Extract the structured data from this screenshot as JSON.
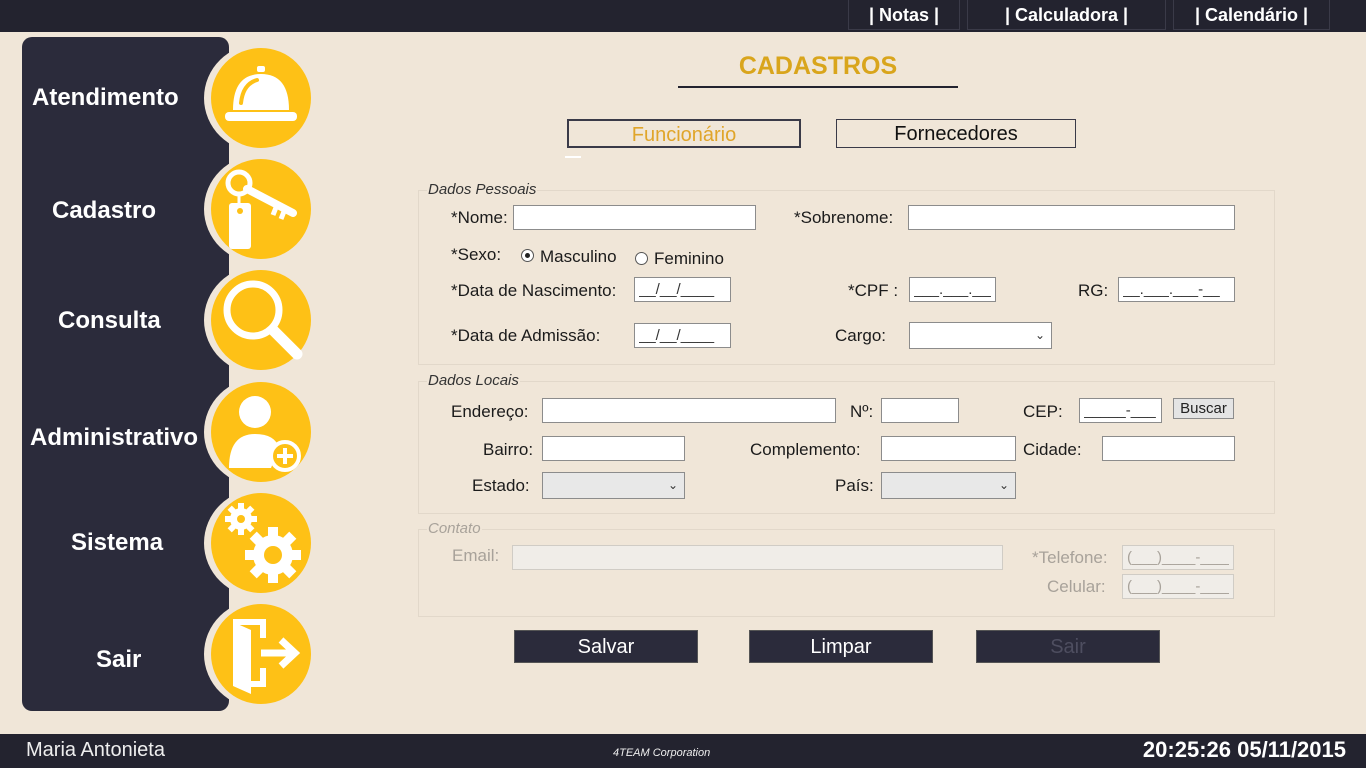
{
  "topbar": {
    "notas": "| Notas |",
    "calculadora": "| Calculadora |",
    "calendario": "| Calendário |"
  },
  "sidebar": {
    "items": [
      {
        "label": "Atendimento",
        "icon": "service-bell-icon"
      },
      {
        "label": "Cadastro",
        "icon": "key-tag-icon"
      },
      {
        "label": "Consulta",
        "icon": "magnifier-icon"
      },
      {
        "label": "Administrativo",
        "icon": "add-user-icon"
      },
      {
        "label": "Sistema",
        "icon": "gears-icon"
      },
      {
        "label": "Sair",
        "icon": "exit-door-icon"
      }
    ]
  },
  "page": {
    "title": "CADASTROS",
    "tabs": [
      "Funcionário",
      "Fornecedores"
    ],
    "active_tab": "Funcionário"
  },
  "dados_pessoais": {
    "title": "Dados Pessoais",
    "nome_label": "*Nome:",
    "sobrenome_label": "*Sobrenome:",
    "sexo_label": "*Sexo:",
    "sexo_options": [
      "Masculino",
      "Feminino"
    ],
    "sexo_selected": "Masculino",
    "nascimento_label": "*Data de Nascimento:",
    "nascimento_mask": "__/__/____",
    "cpf_label": "*CPF :",
    "cpf_mask": "___.___.___-__",
    "rg_label": "RG:",
    "rg_mask": "__.___.___-__",
    "admissao_label": "*Data de Admissão:",
    "admissao_mask": "__/__/____",
    "cargo_label": "Cargo:"
  },
  "dados_locais": {
    "title": "Dados Locais",
    "endereco_label": "Endereço:",
    "numero_label": "Nº:",
    "cep_label": "CEP:",
    "cep_mask": "_____-___",
    "buscar": "Buscar",
    "bairro_label": "Bairro:",
    "complemento_label": "Complemento:",
    "cidade_label": "Cidade:",
    "estado_label": "Estado:",
    "pais_label": "País:"
  },
  "contato": {
    "title": "Contato",
    "email_label": "Email:",
    "telefone_label": "*Telefone:",
    "telefone_mask": "(___)____-____",
    "celular_label": "Celular:",
    "celular_mask": "(___)____-____"
  },
  "actions": {
    "salvar": "Salvar",
    "limpar": "Limpar",
    "sair": "Sair"
  },
  "statusbar": {
    "user": "Maria Antonieta",
    "company": "4TEAM Corporation",
    "datetime": "20:25:26 05/11/2015"
  },
  "colors": {
    "accent": "#fec116",
    "title": "#d9a51c",
    "dark": "#2b2b3b",
    "background": "#f0e6d8"
  }
}
